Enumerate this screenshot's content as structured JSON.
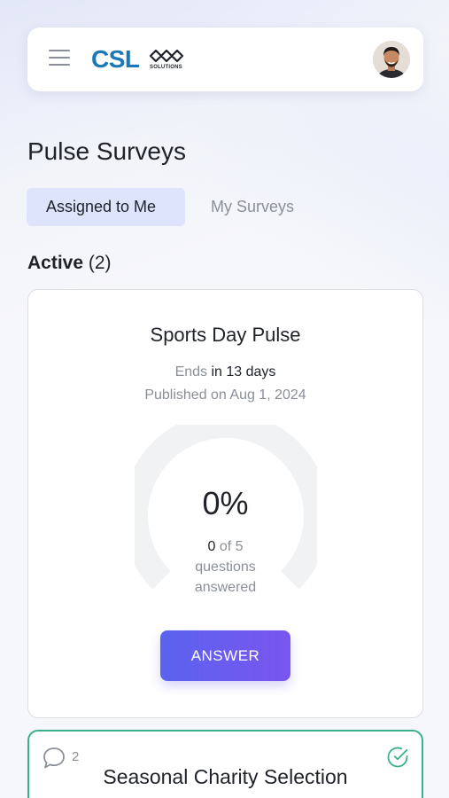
{
  "header": {
    "logo_text": "CSL",
    "logo_sub": "SOLUTIONS",
    "menu_icon": "hamburger-menu-icon",
    "avatar_icon": "user-avatar"
  },
  "page": {
    "title": "Pulse Surveys"
  },
  "tabs": [
    {
      "label": "Assigned to Me",
      "active": true
    },
    {
      "label": "My Surveys",
      "active": false
    }
  ],
  "section": {
    "label": "Active",
    "count": "(2)"
  },
  "surveys": [
    {
      "title": "Sports Day Pulse",
      "ends_prefix": "Ends",
      "ends_value": "in 13 days",
      "published": "Published on Aug 1, 2024",
      "progress_percent": "0%",
      "progress_fraction": 0,
      "answered": "0",
      "answered_suffix": "of 5",
      "answered_line2": "questions",
      "answered_line3": "answered",
      "button_label": "ANSWER"
    },
    {
      "title": "Seasonal Charity Selection",
      "comment_count": "2",
      "comment_icon": "comment-bubble-icon",
      "status_icon": "check-circle-icon"
    }
  ],
  "colors": {
    "accent": "#5a63ee",
    "accent_end": "#7a55f0",
    "tab_active_bg": "#dde4fb",
    "success": "#3bb08c",
    "logo_blue": "#1a78b8"
  }
}
